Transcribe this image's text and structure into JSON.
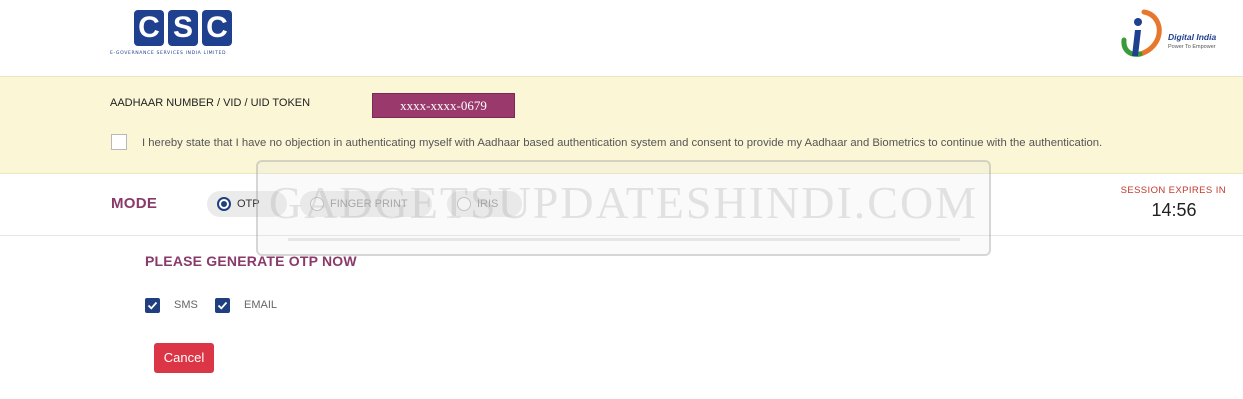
{
  "header": {
    "csc_logo": {
      "letters": [
        "C",
        "S",
        "C"
      ],
      "subtitle": "e-Governance Services India Limited"
    },
    "digital_india_logo": {
      "title": "Digital India",
      "tagline": "Power To Empower"
    }
  },
  "aadhaar": {
    "label": "AADHAAR NUMBER / VID / UID TOKEN",
    "value": "xxxx-xxxx-0679",
    "consent_checked": false,
    "consent_text": "I hereby state that I have no objection in authenticating myself with Aadhaar based authentication system and consent to provide my Aadhaar and Biometrics to continue with the authentication."
  },
  "mode": {
    "label": "MODE",
    "options": [
      {
        "label": "OTP",
        "selected": true
      },
      {
        "label": "FINGER PRINT",
        "selected": false
      },
      {
        "label": "IRIS",
        "selected": false
      }
    ]
  },
  "session": {
    "label": "SESSION EXPIRES IN",
    "time": "14:56"
  },
  "otp": {
    "heading": "PLEASE GENERATE OTP NOW",
    "channels": [
      {
        "label": "SMS",
        "checked": true
      },
      {
        "label": "EMAIL",
        "checked": true
      }
    ]
  },
  "actions": {
    "cancel_label": "Cancel"
  },
  "watermark": {
    "text": "GADGETSUPDATESHINDI.COM"
  },
  "colors": {
    "brand_blue": "#1f3f8f",
    "mode_maroon": "#8a3a6a",
    "aadhaar_badge": "#9a3a6c",
    "band_yellow": "#fbf6d6",
    "cancel_red": "#dc3545",
    "session_red": "#c0392b"
  }
}
